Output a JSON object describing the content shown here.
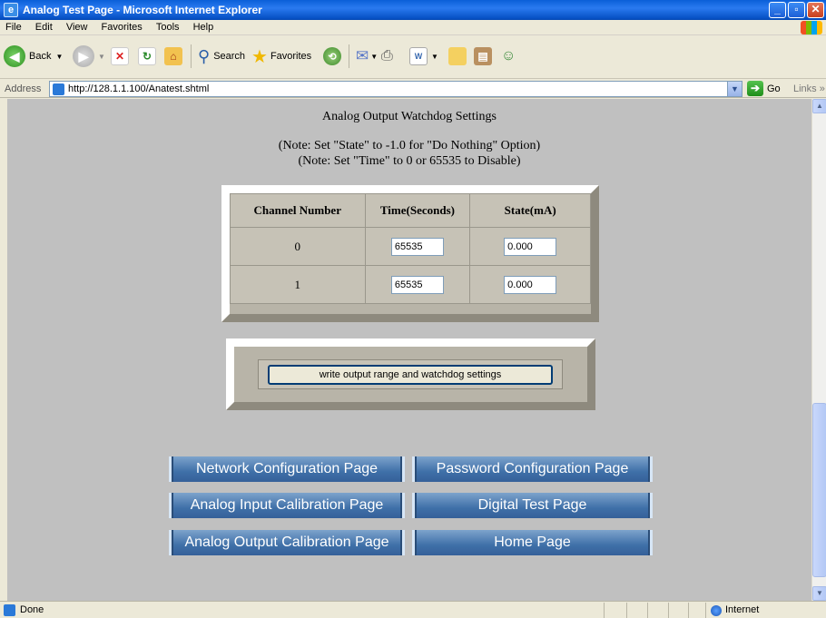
{
  "window": {
    "title": "Analog Test Page - Microsoft Internet Explorer"
  },
  "menu": [
    "File",
    "Edit",
    "View",
    "Favorites",
    "Tools",
    "Help"
  ],
  "toolbar": {
    "back_label": "Back",
    "search_label": "Search",
    "favorites_label": "Favorites"
  },
  "address": {
    "label": "Address",
    "url": "http://128.1.1.100/Anatest.shtml",
    "go_label": "Go",
    "links_label": "Links"
  },
  "page": {
    "heading": "Analog Output Watchdog Settings",
    "note1": "(Note: Set \"State\" to -1.0 for \"Do Nothing\" Option)",
    "note2": "(Note: Set \"Time\" to 0 or 65535 to Disable)",
    "table": {
      "headers": [
        "Channel Number",
        "Time(Seconds)",
        "State(mA)"
      ],
      "rows": [
        {
          "channel": "0",
          "time": "65535",
          "state": "0.000"
        },
        {
          "channel": "1",
          "time": "65535",
          "state": "0.000"
        }
      ]
    },
    "write_button": "write output range and watchdog settings",
    "nav": {
      "network": "Network Configuration Page",
      "password": "Password Configuration Page",
      "analog_input": "Analog Input Calibration Page",
      "digital": "Digital Test Page",
      "analog_output": "Analog Output Calibration Page",
      "home": "Home Page"
    }
  },
  "status": {
    "text": "Done",
    "zone": "Internet"
  }
}
